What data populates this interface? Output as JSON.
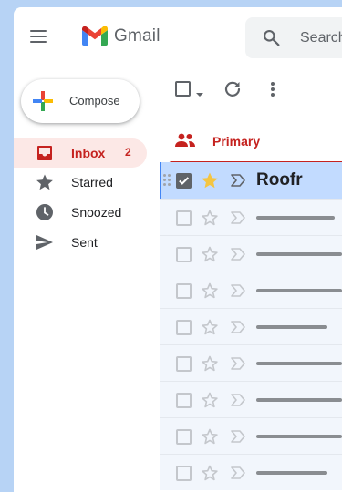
{
  "app": {
    "name": "Gmail"
  },
  "search": {
    "placeholder": "Search mail"
  },
  "sidebar": {
    "compose_label": "Compose",
    "items": [
      {
        "label": "Inbox",
        "count": "2",
        "icon": "inbox-icon",
        "active": true
      },
      {
        "label": "Starred",
        "icon": "star-icon"
      },
      {
        "label": "Snoozed",
        "icon": "clock-icon"
      },
      {
        "label": "Sent",
        "icon": "send-icon"
      }
    ]
  },
  "tabs": [
    {
      "label": "Primary",
      "icon": "people-icon",
      "active": true
    }
  ],
  "messages": [
    {
      "sender": "Roofr",
      "selected": true,
      "starred": true
    },
    {
      "sender": ""
    },
    {
      "sender": ""
    },
    {
      "sender": ""
    },
    {
      "sender": ""
    },
    {
      "sender": ""
    },
    {
      "sender": ""
    },
    {
      "sender": ""
    },
    {
      "sender": ""
    }
  ],
  "colors": {
    "accent_red": "#c5221f",
    "selected_row": "#c2dbff",
    "star_gold": "#f4c542",
    "background": "#b7d3f5"
  }
}
